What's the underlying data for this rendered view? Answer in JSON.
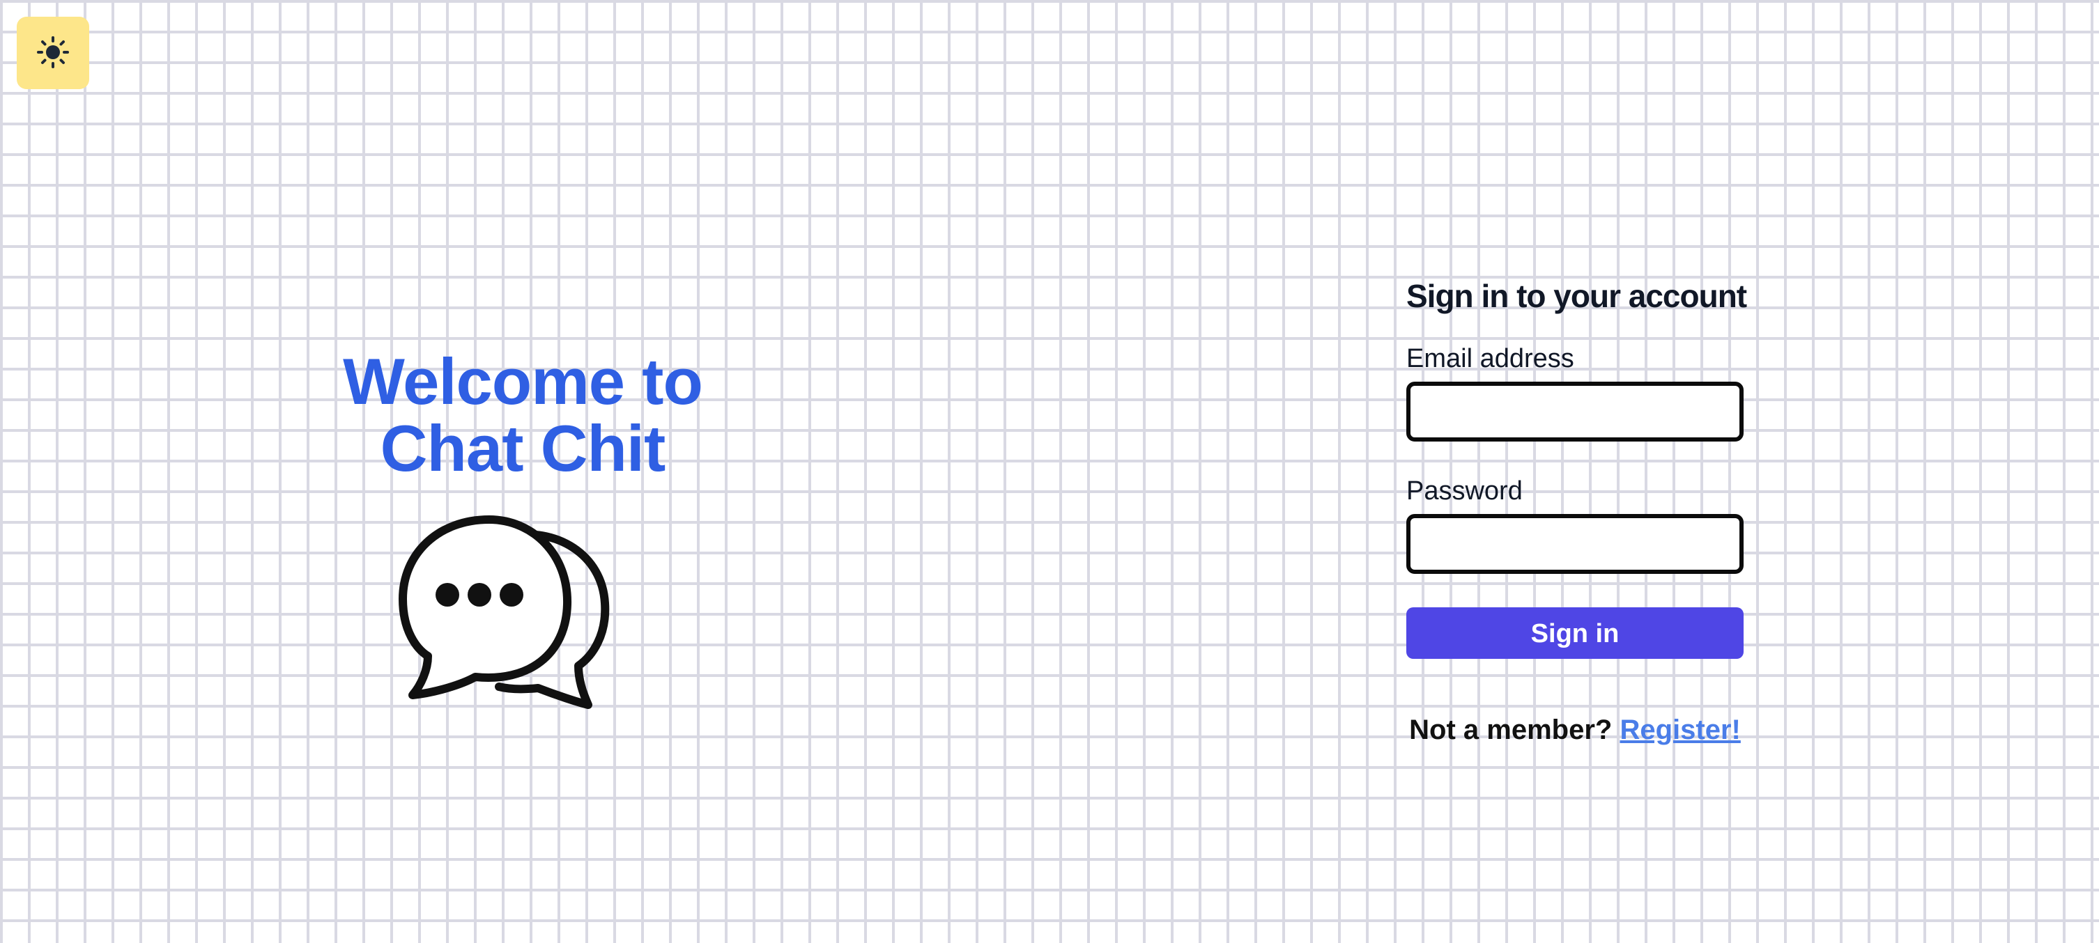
{
  "theme_toggle": {
    "icon": "sun-icon",
    "background": "#fde68a"
  },
  "hero": {
    "title_line1": "Welcome to",
    "title_line2": "Chat Chit",
    "title_color": "#2f5fe3",
    "icon": "chat-bubbles-icon"
  },
  "signin_form": {
    "heading": "Sign in to your account",
    "email_label": "Email address",
    "email_value": "",
    "password_label": "Password",
    "password_value": "",
    "submit_label": "Sign in",
    "submit_color": "#4f46e5",
    "register_prompt": "Not a member?",
    "register_link": "Register!",
    "register_link_color": "#4a7de8"
  },
  "background": {
    "pattern": "brick",
    "line_color": "#d9d9e3"
  }
}
